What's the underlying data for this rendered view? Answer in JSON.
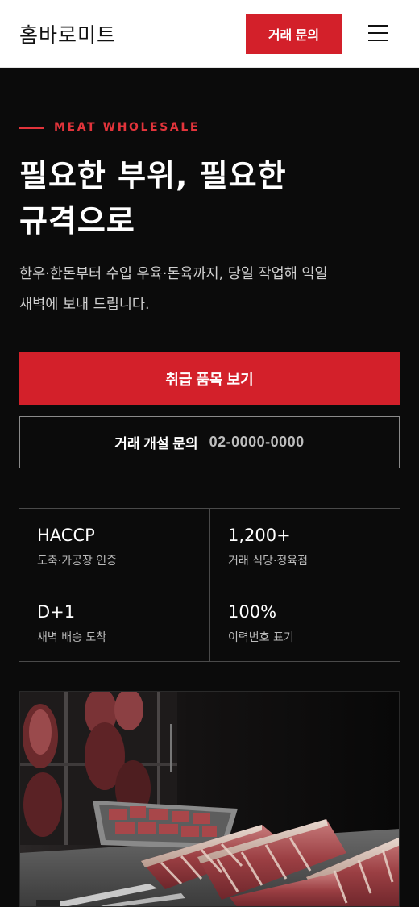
{
  "header": {
    "brand": "홈바로미트",
    "cta_label": "거래 문의"
  },
  "hero": {
    "eyebrow": "MEAT WHOLESALE",
    "headline_line1": "필요한 부위, 필요한",
    "headline_line2": "규격으로",
    "sub_line1": "한우·한돈부터 수입 우육·돈육까지, 당일 작업해 익일",
    "sub_line2": "새벽에 보내 드립니다.",
    "primary_button": "취급 품목 보기",
    "contact_label": "거래 개설 문의",
    "contact_number": "02-0000-0000"
  },
  "stats": [
    {
      "value": "HACCP",
      "label": "도축·가공장 인증"
    },
    {
      "value": "1,200+",
      "label": "거래 식당·정육점"
    },
    {
      "value": "D+1",
      "label": "새벽 배송 도착"
    },
    {
      "value": "100%",
      "label": "이력번호 표기"
    }
  ],
  "colors": {
    "accent": "#d3202a",
    "background": "#0b0b0b",
    "header_bg": "#ffffff"
  }
}
